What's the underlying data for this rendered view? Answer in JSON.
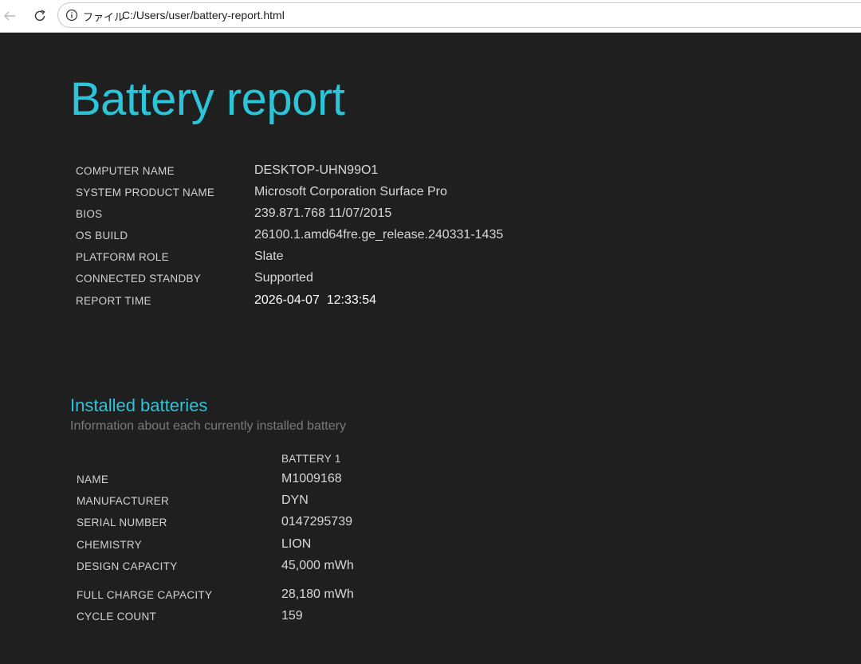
{
  "browser": {
    "back_icon": "arrow-left-icon",
    "reload_icon": "reload-icon",
    "info_icon": "info-circle-icon",
    "scheme_label": "ファイル",
    "url": "C:/Users/user/battery-report.html"
  },
  "report": {
    "title": "Battery report",
    "system_info": [
      {
        "key": "COMPUTER NAME",
        "value": "DESKTOP-UHN99O1"
      },
      {
        "key": "SYSTEM PRODUCT NAME",
        "value": "Microsoft Corporation Surface Pro"
      },
      {
        "key": "BIOS",
        "value": "239.871.768 11/07/2015"
      },
      {
        "key": "OS BUILD",
        "value": "26100.1.amd64fre.ge_release.240331-1435"
      },
      {
        "key": "PLATFORM ROLE",
        "value": "Slate"
      },
      {
        "key": "CONNECTED STANDBY",
        "value": "Supported"
      },
      {
        "key": "REPORT TIME",
        "value": "2026-04-07  12:33:54"
      }
    ]
  },
  "installed_batteries": {
    "title": "Installed batteries",
    "subtitle": "Information about each currently installed battery",
    "column_header": "BATTERY 1",
    "rows": [
      {
        "key": "NAME",
        "value": "M1009168"
      },
      {
        "key": "MANUFACTURER",
        "value": "DYN"
      },
      {
        "key": "SERIAL NUMBER",
        "value": "0147295739"
      },
      {
        "key": "CHEMISTRY",
        "value": "LION"
      },
      {
        "key": "DESIGN CAPACITY",
        "value": "45,000 mWh"
      },
      {
        "key": "FULL CHARGE CAPACITY",
        "value": "28,180 mWh"
      },
      {
        "key": "CYCLE COUNT",
        "value": "159"
      }
    ]
  },
  "colors": {
    "accent": "#2bc4d8",
    "background": "#1f1f1f",
    "label": "#d2d2d2",
    "muted": "#7a7a7a"
  }
}
